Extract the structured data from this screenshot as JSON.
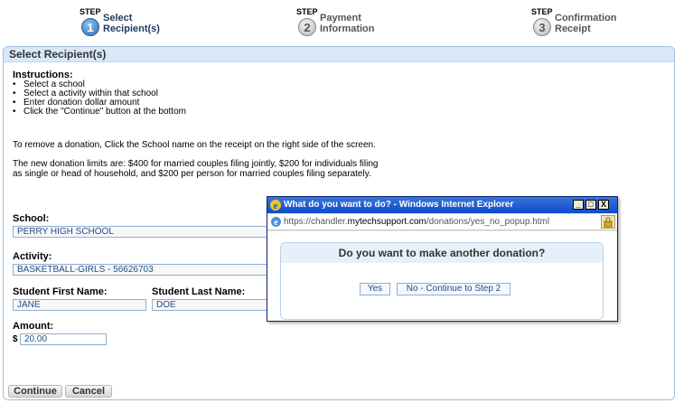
{
  "steps": [
    {
      "word": "STEP",
      "number": "1",
      "label_line1": "Select",
      "label_line2": "Recipient(s)",
      "active": true
    },
    {
      "word": "STEP",
      "number": "2",
      "label_line1": "Payment",
      "label_line2": "Information",
      "active": false
    },
    {
      "word": "STEP",
      "number": "3",
      "label_line1": "Confirmation",
      "label_line2": "Receipt",
      "active": false
    }
  ],
  "panel": {
    "title": "Select Recipient(s)",
    "instructions_title": "Instructions:",
    "instructions": [
      "Select a school",
      "Select a activity within that school",
      "Enter donation dollar amount",
      "Click the \"Continue\" button at the bottom"
    ],
    "remove_note": "To remove a donation, Click the School name on the receipt on the right side of the screen.",
    "limits_line1": "The new donation limits are: $400 for married couples filing jointly, $200 for individuals filing",
    "limits_line2": "as single or head of household, and $200 per person for married couples filing separately."
  },
  "form": {
    "school_label": "School:",
    "school_value": "PERRY HIGH SCHOOL",
    "activity_label": "Activity:",
    "activity_value": "BASKETBALL-GIRLS - 56626703",
    "first_name_label": "Student First Name:",
    "first_name_value": "JANE",
    "last_name_label": "Student Last Name:",
    "last_name_value": "DOE",
    "amount_label": "Amount:",
    "currency_symbol": "$",
    "amount_value": "20.00"
  },
  "buttons": {
    "continue": "Continue",
    "cancel": "Cancel"
  },
  "popup": {
    "title": "What do you want to do? - Windows Internet Explorer",
    "url_prefix": "https://chandler.",
    "url_domain": "mytechsupport.com",
    "url_path": "/donations/yes_no_popup.html",
    "question": "Do you want to make another donation?",
    "yes_label": "Yes",
    "no_label": "No - Continue to Step 2",
    "minimize": "_",
    "maximize": "□",
    "close": "X"
  },
  "colors": {
    "accent_blue": "#2b6fb5",
    "panel_header": "#d9e8f7",
    "titlebar": "#0b4dcf"
  },
  "icons": {
    "step_active": "step-number-active-icon",
    "step_inactive": "step-number-inactive-icon",
    "browser": "internet-explorer-icon",
    "lock": "lock-icon"
  }
}
